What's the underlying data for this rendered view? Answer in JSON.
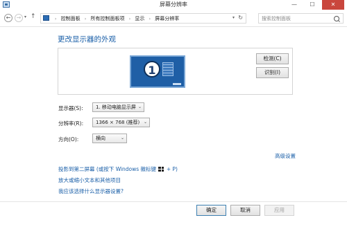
{
  "window": {
    "title": "屏幕分辨率",
    "minimize_label": "—",
    "maximize_label": "☐",
    "close_label": "✕"
  },
  "addressbar": {
    "back_glyph": "←",
    "forward_glyph": "→",
    "recent_glyph": "▾",
    "up_glyph": "↑",
    "breadcrumbs": [
      "控制面板",
      "所有控制面板项",
      "显示",
      "屏幕分辨率"
    ],
    "separator": "›",
    "dropdown_glyph": "▾",
    "refresh_glyph": "↻",
    "search_placeholder": "搜索控制面板"
  },
  "main": {
    "heading": "更改显示器的外观",
    "monitor_number": "1",
    "detect_label": "检测(C)",
    "identify_label": "识别(I)"
  },
  "settings": {
    "display_label": "显示器(S):",
    "display_value": "1. 移动电脑显示屏",
    "resolution_label": "分辨率(R):",
    "resolution_value": "1366 × 768 (推荐)",
    "orientation_label": "方向(O):",
    "orientation_value": "横向",
    "chevron": "⌄"
  },
  "links": {
    "advanced": "高级设置",
    "project_prefix": "投影到第二屏幕 (或按下 Windows 徽标键",
    "project_suffix": "+ P)",
    "text_size": "放大或缩小文本和其他项目",
    "which_settings": "我应该选择什么显示器设置?"
  },
  "footer": {
    "ok_label": "确定",
    "cancel_label": "取消",
    "apply_label": "应用"
  }
}
